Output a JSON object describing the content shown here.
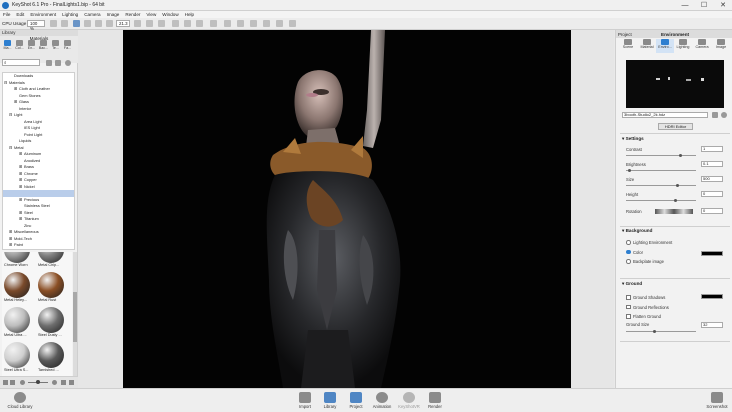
{
  "window": {
    "title": "KeyShot 6.1 Pro  -  FinalLights1.bip  -  64 bit",
    "minimize": "—",
    "maximize": "☐",
    "close": "✕"
  },
  "menu": [
    "File",
    "Edit",
    "Environment",
    "Lighting",
    "Camera",
    "Image",
    "Render",
    "View",
    "Window",
    "Help"
  ],
  "toolbar": {
    "cpu_label": "CPU Usage",
    "cpu_value": "100 %",
    "zoom_value": "21.3"
  },
  "library": {
    "panel_title": "Library",
    "section_title": "Materials",
    "tabs": [
      "Ma...",
      "Col...",
      "En...",
      "Bac...",
      "Te...",
      "Fa..."
    ],
    "tree": [
      {
        "label": "Downloads",
        "indent": 1,
        "toggle": ""
      },
      {
        "label": "Materials",
        "indent": 0,
        "toggle": "⊟"
      },
      {
        "label": "Cloth and Leather",
        "indent": 2,
        "toggle": "⊞"
      },
      {
        "label": "Gem Stones",
        "indent": 2,
        "toggle": ""
      },
      {
        "label": "Glass",
        "indent": 2,
        "toggle": "⊞"
      },
      {
        "label": "Interior",
        "indent": 2,
        "toggle": ""
      },
      {
        "label": "Light",
        "indent": 1,
        "toggle": "⊟"
      },
      {
        "label": "Area Light",
        "indent": 3,
        "toggle": ""
      },
      {
        "label": "IES Light",
        "indent": 3,
        "toggle": ""
      },
      {
        "label": "Point Light",
        "indent": 3,
        "toggle": ""
      },
      {
        "label": "Liquids",
        "indent": 2,
        "toggle": ""
      },
      {
        "label": "Metal",
        "indent": 1,
        "toggle": "⊟"
      },
      {
        "label": "Aluminum",
        "indent": 3,
        "toggle": "⊞"
      },
      {
        "label": "Anodized",
        "indent": 3,
        "toggle": ""
      },
      {
        "label": "Brass",
        "indent": 3,
        "toggle": "⊞"
      },
      {
        "label": "Chrome",
        "indent": 3,
        "toggle": "⊞"
      },
      {
        "label": "Copper",
        "indent": 3,
        "toggle": "⊞"
      },
      {
        "label": "Nickel",
        "indent": 3,
        "toggle": "⊞"
      },
      {
        "label": "",
        "indent": 3,
        "toggle": "",
        "selected": true
      },
      {
        "label": "Precious",
        "indent": 3,
        "toggle": "⊞"
      },
      {
        "label": "Stainless Steel",
        "indent": 3,
        "toggle": ""
      },
      {
        "label": "Steel",
        "indent": 3,
        "toggle": "⊞"
      },
      {
        "label": "Titanium",
        "indent": 3,
        "toggle": "⊞"
      },
      {
        "label": "Zinc",
        "indent": 3,
        "toggle": ""
      },
      {
        "label": "Miscellaneous",
        "indent": 1,
        "toggle": "⊞"
      },
      {
        "label": "Mold-Tech",
        "indent": 1,
        "toggle": "⊞"
      },
      {
        "label": "Paint",
        "indent": 1,
        "toggle": "⊞"
      }
    ],
    "thumbnails": [
      {
        "label": "Chrome Worn",
        "color": "#9a9a9a"
      },
      {
        "label": "Metal Chip...",
        "color": "#7f7f7f"
      },
      {
        "label": "Metal Heley...",
        "color": "#7a4a2b"
      },
      {
        "label": "Metal Rust",
        "color": "#8b4f25"
      },
      {
        "label": "Metal Ultra ...",
        "color": "#bdbdbd"
      },
      {
        "label": "Steel Dusty ...",
        "color": "#6e6e6e"
      },
      {
        "label": "Steel Ultra S...",
        "color": "#cfcfcf"
      },
      {
        "label": "Tarnished ...",
        "color": "#5a5a5a"
      }
    ]
  },
  "project": {
    "panel_title": "Project",
    "section_title": "Environment",
    "tabs": [
      "Scene",
      "Material",
      "Enviro...",
      "Lighting",
      "Camera",
      "Image"
    ],
    "active_tab": 2,
    "hdri_file": "3booth-Studio2_2k.hdz",
    "hdri_editor_label": "HDRI Editor",
    "settings_title": "Settings",
    "settings": [
      {
        "label": "Contrast",
        "value": "1",
        "slider": 0.78
      },
      {
        "label": "Brightness",
        "value": "0.1",
        "slider": 0.05
      },
      {
        "label": "Size",
        "value": "500",
        "slider": 0.73
      },
      {
        "label": "Height",
        "value": "0",
        "slider": 0.7
      }
    ],
    "rotation_label": "Rotation",
    "rotation_value": "0",
    "background_title": "Background",
    "background_options": [
      {
        "label": "Lighting Environment",
        "selected": false
      },
      {
        "label": "Color",
        "selected": true
      },
      {
        "label": "Backplate image",
        "selected": false
      }
    ],
    "background_color": "#000000",
    "ground_title": "Ground",
    "ground_options": [
      "Ground Shadows",
      "Ground Reflections",
      "Flatten Ground"
    ],
    "ground_size_label": "Ground Size",
    "ground_size_value": "32",
    "ground_size_slider": 0.4
  },
  "bottombar": {
    "cloud_library": "Cloud Library",
    "buttons": [
      "Import",
      "Library",
      "Project",
      "Animation",
      "KeyShotVR",
      "Render"
    ],
    "screenshot": "Screenshot"
  }
}
